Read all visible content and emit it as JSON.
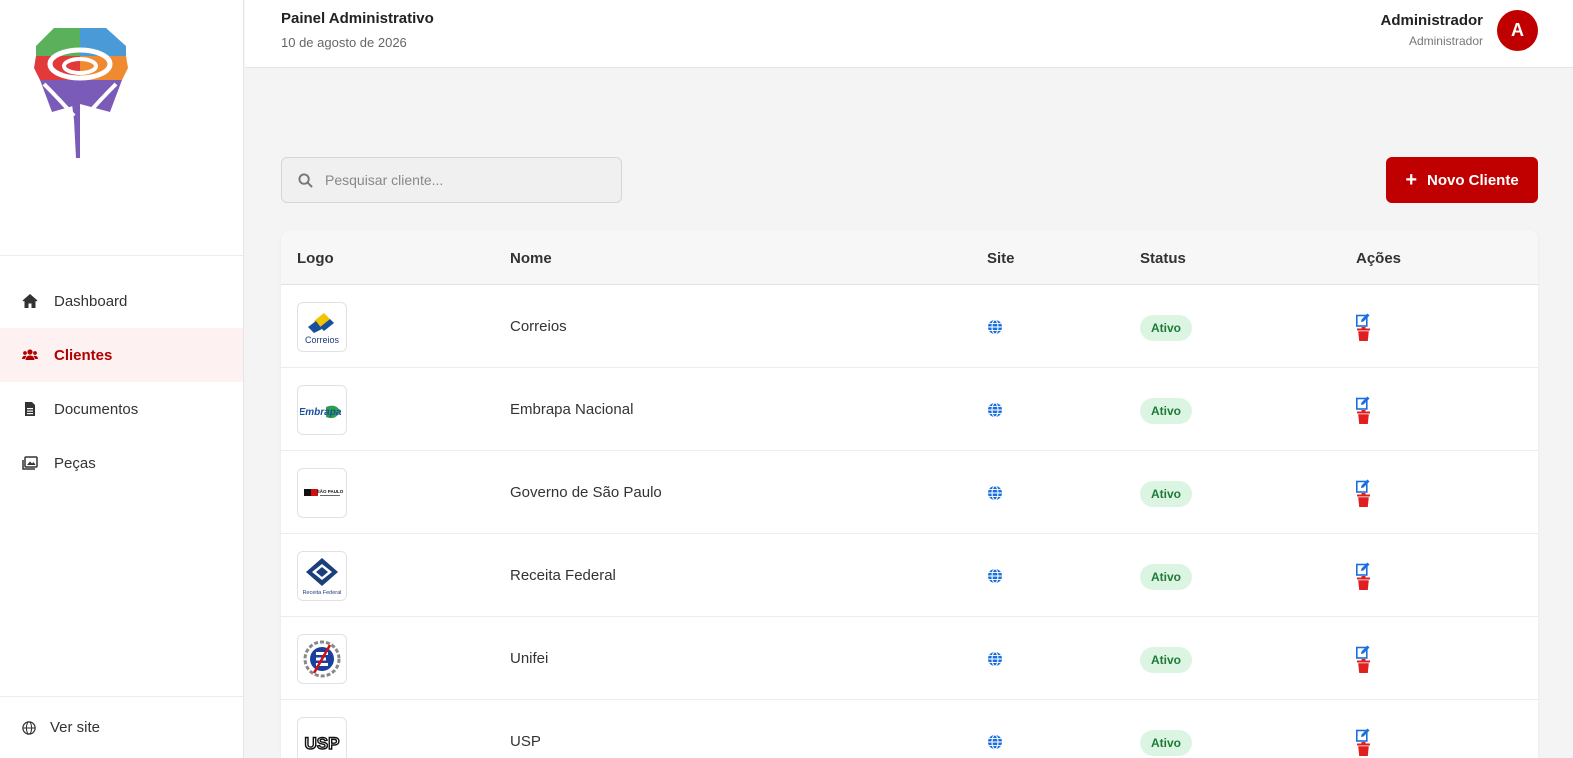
{
  "sidebar": {
    "logo_icon": "brand-logo",
    "items": [
      {
        "label": "Dashboard",
        "icon": "home-icon"
      },
      {
        "label": "Clientes",
        "icon": "users-icon"
      },
      {
        "label": "Documentos",
        "icon": "document-icon"
      },
      {
        "label": "Peças",
        "icon": "images-icon"
      }
    ],
    "active": "Clientes",
    "footer_label": "Ver site"
  },
  "header": {
    "title": "Painel Administrativo",
    "date": "10 de agosto de 2026",
    "user_name": "Administrador",
    "user_role": "Administrador",
    "avatar_letter": "A"
  },
  "toolbar": {
    "search_placeholder": "Pesquisar cliente...",
    "new_button_label": "Novo Cliente"
  },
  "table": {
    "columns": [
      "Logo",
      "Nome",
      "Site",
      "Status",
      "Ações"
    ],
    "rows": [
      {
        "name": "Correios",
        "status": "Ativo",
        "logo": "correios-logo",
        "logo_text": "Correios"
      },
      {
        "name": "Embrapa Nacional",
        "status": "Ativo",
        "logo": "embrapa-logo",
        "logo_text": "Embrapa"
      },
      {
        "name": "Governo de São Paulo",
        "status": "Ativo",
        "logo": "sp-gov-logo",
        "logo_text": "SÃO PAULO"
      },
      {
        "name": "Receita Federal",
        "status": "Ativo",
        "logo": "receita-federal-logo",
        "logo_text": "Receita Federal"
      },
      {
        "name": "Unifei",
        "status": "Ativo",
        "logo": "unifei-logo",
        "logo_text": ""
      },
      {
        "name": "USP",
        "status": "Ativo",
        "logo": "usp-logo",
        "logo_text": "USP"
      }
    ]
  },
  "colors": {
    "brand_red": "#c00000",
    "active_bg": "#fdf1f1",
    "badge_bg": "#dcf5e3",
    "badge_text": "#1f7a38",
    "link_blue": "#1a6fdc",
    "delete_red": "#e02020"
  }
}
